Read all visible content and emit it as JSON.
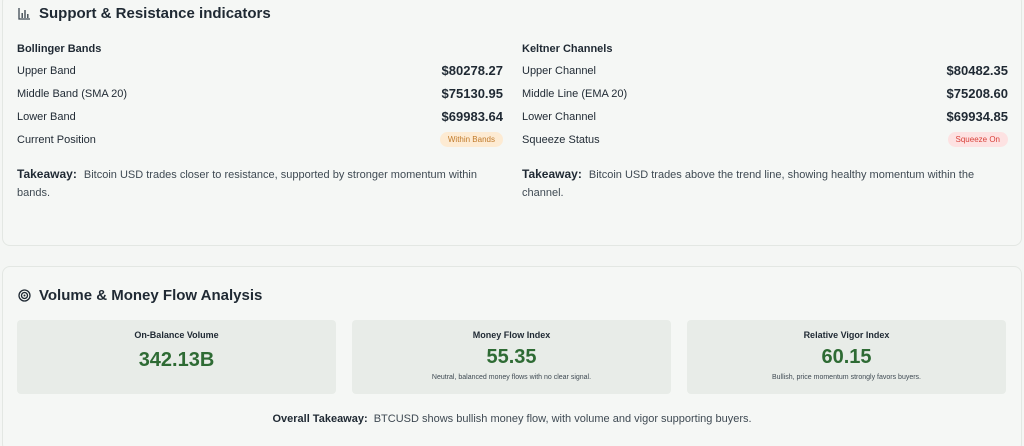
{
  "support_resistance": {
    "title": "Support & Resistance indicators",
    "icon": "bar-chart-icon",
    "bollinger": {
      "title": "Bollinger Bands",
      "rows": [
        {
          "label": "Upper Band",
          "value": "$80278.27"
        },
        {
          "label": "Middle Band (SMA 20)",
          "value": "$75130.95"
        },
        {
          "label": "Lower Band",
          "value": "$69983.64"
        }
      ],
      "position_label": "Current Position",
      "position_badge": "Within Bands",
      "takeaway_label": "Takeaway:",
      "takeaway_text": "Bitcoin USD trades closer to resistance, supported by stronger momentum within bands."
    },
    "keltner": {
      "title": "Keltner Channels",
      "rows": [
        {
          "label": "Upper Channel",
          "value": "$80482.35"
        },
        {
          "label": "Middle Line (EMA 20)",
          "value": "$75208.60"
        },
        {
          "label": "Lower Channel",
          "value": "$69934.85"
        }
      ],
      "squeeze_label": "Squeeze Status",
      "squeeze_badge": "Squeeze On",
      "takeaway_label": "Takeaway:",
      "takeaway_text": "Bitcoin USD trades above the trend line, showing healthy momentum within the channel."
    }
  },
  "volume": {
    "title": "Volume & Money Flow Analysis",
    "icon": "target-icon",
    "metrics": [
      {
        "label": "On-Balance Volume",
        "value": "342.13B",
        "desc": ""
      },
      {
        "label": "Money Flow Index",
        "value": "55.35",
        "desc": "Neutral, balanced money flows with no clear signal."
      },
      {
        "label": "Relative Vigor Index",
        "value": "60.15",
        "desc": "Bullish, price momentum strongly favors buyers."
      }
    ],
    "overall_label": "Overall Takeaway:",
    "overall_text": "BTCUSD shows bullish money flow, with volume and vigor supporting buyers."
  },
  "colors": {
    "value_green": "#2e6b34",
    "badge_amber": "#fdebd3",
    "badge_red": "#fde2e2"
  }
}
